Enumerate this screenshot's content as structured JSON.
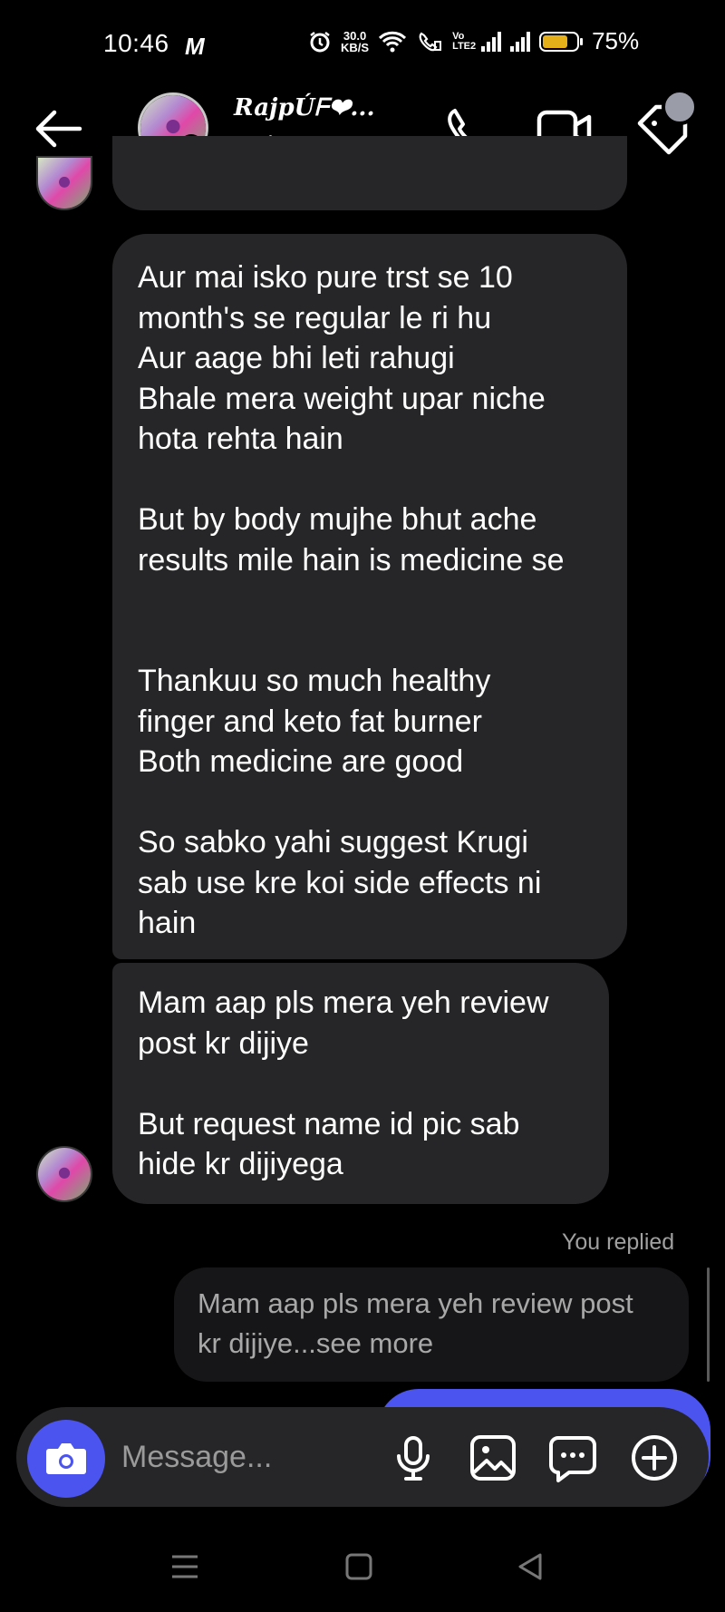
{
  "status_bar": {
    "time": "10:46",
    "carrier_glyph": "M",
    "net_speed_value": "30.0",
    "net_speed_unit": "KB/S",
    "lte_label": "Vo LTE2",
    "battery_percent": "75%",
    "battery_level": 0.75,
    "icons": [
      "alarm-icon",
      "wifi-icon",
      "wifi-call-icon",
      "signal-icon",
      "signal-icon",
      "battery-icon"
    ]
  },
  "header": {
    "contact_name": "RajpÚᖴ❤...",
    "status": "Active now",
    "icons": [
      "back-arrow-icon",
      "phone-icon",
      "video-camera-icon",
      "tag-icon"
    ]
  },
  "messages": {
    "message1": "Aur mai isko pure trst se 10\nmonth's se regular le ri hu\nAur aage bhi leti rahugi\nBhale mera weight upar niche\nhota rehta hain\n\nBut by body mujhe bhut ache\nresults mile hain is medicine se\n\n\nThankuu so much healthy\nfinger and keto fat burner\nBoth medicine are good\n\nSo sabko yahi suggest Krugi\nsab use kre koi side effects ni\nhain",
    "message2": "Mam aap pls mera yeh review\npost kr dijiye\n\nBut request name id pic sab\nhide kr dijiyega",
    "you_replied_label": "You replied",
    "reply_quote": "Mam aap pls mera yeh review post\nkr dijiye...see more"
  },
  "composer": {
    "placeholder": "Message...",
    "value": "",
    "icons": [
      "camera-icon",
      "microphone-icon",
      "gallery-icon",
      "sticker-icon",
      "plus-icon"
    ],
    "accent_color": "#4c54f0"
  },
  "nav_bar": {
    "icons": [
      "menu-icon",
      "home-icon",
      "back-triangle-icon"
    ]
  }
}
